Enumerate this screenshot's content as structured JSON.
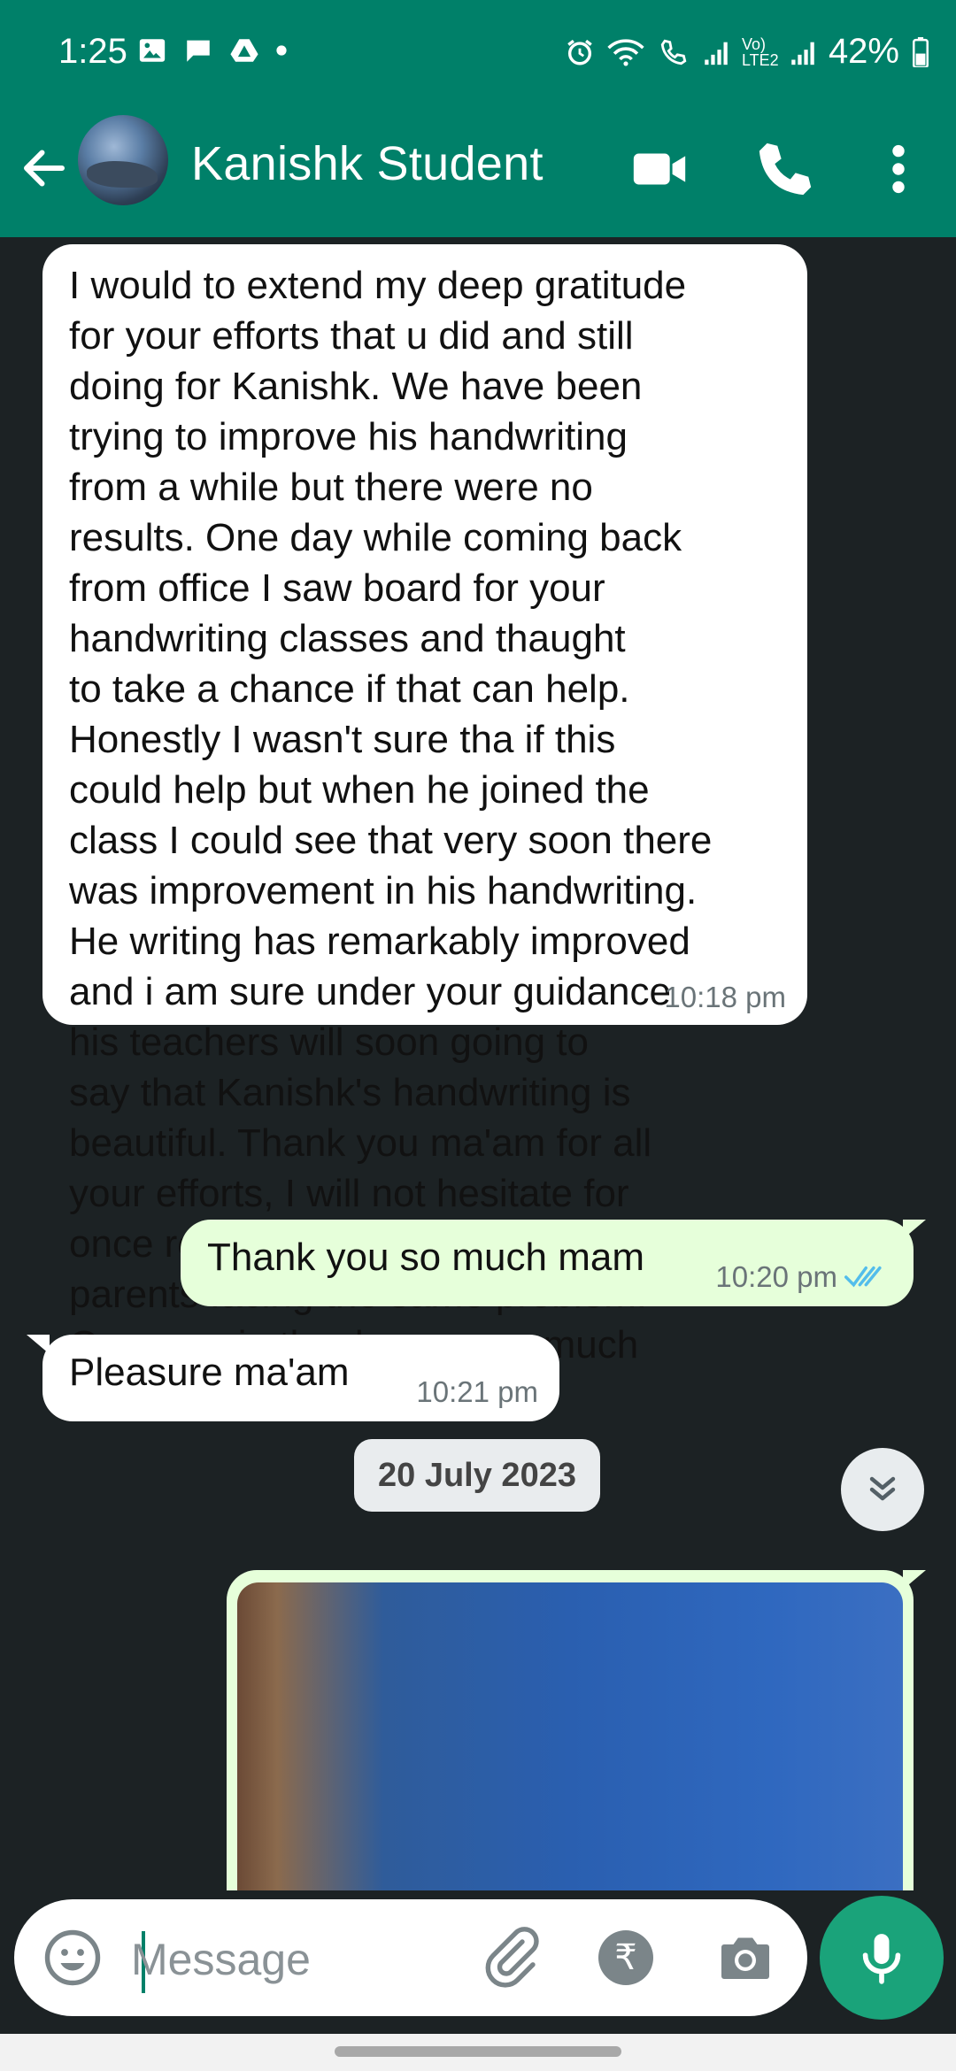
{
  "status_bar": {
    "time": "1:25",
    "battery": "42%",
    "network": "Vo) LTE2"
  },
  "header": {
    "contact_name": "Kanishk Student"
  },
  "messages": [
    {
      "direction": "incoming",
      "text": "I would to extend my deep gratitude\nfor your efforts that u did and still\ndoing for Kanishk. We have been\ntrying to improve his handwriting\nfrom a while but there were no\nresults. One day while coming back\nfrom office I saw board for your\nhandwriting classes and thaught\nto take a chance if that can help.\nHonestly I wasn't sure tha if this\ncould help but when he joined the\nclass I could see that very soon there\nwas improvement in his handwriting.\nHe writing has remarkably improved\nand i am sure under your guidance\nhis teachers will soon going to\nsay that Kanishk's handwriting is\nbeautiful. Thank you ma'am for all\nyour efforts, I will not hesitate for\nonce recommending you to other\nparents facing the same problem.\nOnce again thank you very much\nMa'am! 😊",
      "time": "10:18 pm"
    },
    {
      "direction": "outgoing",
      "text": "Thank you so much mam",
      "time": "10:20 pm",
      "status": "read"
    },
    {
      "direction": "incoming",
      "text": "Pleasure ma'am",
      "time": "10:21 pm"
    }
  ],
  "date_separator": "20 July 2023",
  "composer": {
    "placeholder": "Message"
  },
  "colors": {
    "header": "#008069",
    "chat_background": "#1c2224",
    "incoming_bubble": "#ffffff",
    "outgoing_bubble": "#e6ffda",
    "read_ticks": "#53bdeb",
    "mic_button": "#1aa37a"
  }
}
